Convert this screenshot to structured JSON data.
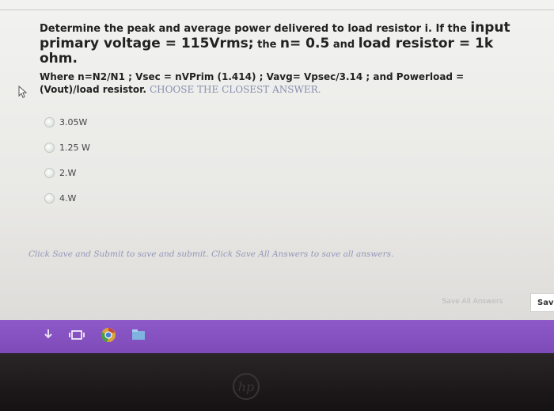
{
  "question": {
    "line1_text": "Determine the peak and average power delivered to load resistor i.  If the ",
    "line1_big": "input",
    "line2_big_a": "primary voltage = 115Vrms;",
    "line2_small_a": " the ",
    "line2_big_b": "n= 0.5",
    "line2_small_b": " and ",
    "line2_big_c": "load resistor = 1k",
    "line3_big": "ohm.",
    "line4": "Where  n=N2/N1 ; Vsec = nVPrim (1.414) ; Vavg= Vpsec/3.14 ;  and Powerload =",
    "line5": "(Vout)/load resistor.",
    "hint": "CHOOSE THE CLOSEST ANSWER."
  },
  "options": [
    {
      "label": "3.05W"
    },
    {
      "label": "1.25 W"
    },
    {
      "label": "2.W"
    },
    {
      "label": "4.W"
    }
  ],
  "instructions": "Click Save and Submit to save and submit. Click Save All Answers to save all answers.",
  "buttons": {
    "save_all": "Save All Answers",
    "save": "Sav"
  },
  "bezel": {
    "logo": "hp"
  },
  "taskbar": {
    "icons": [
      "download-icon",
      "task-view-icon",
      "chrome-icon",
      "file-explorer-icon"
    ],
    "color": "#8a55c4"
  }
}
